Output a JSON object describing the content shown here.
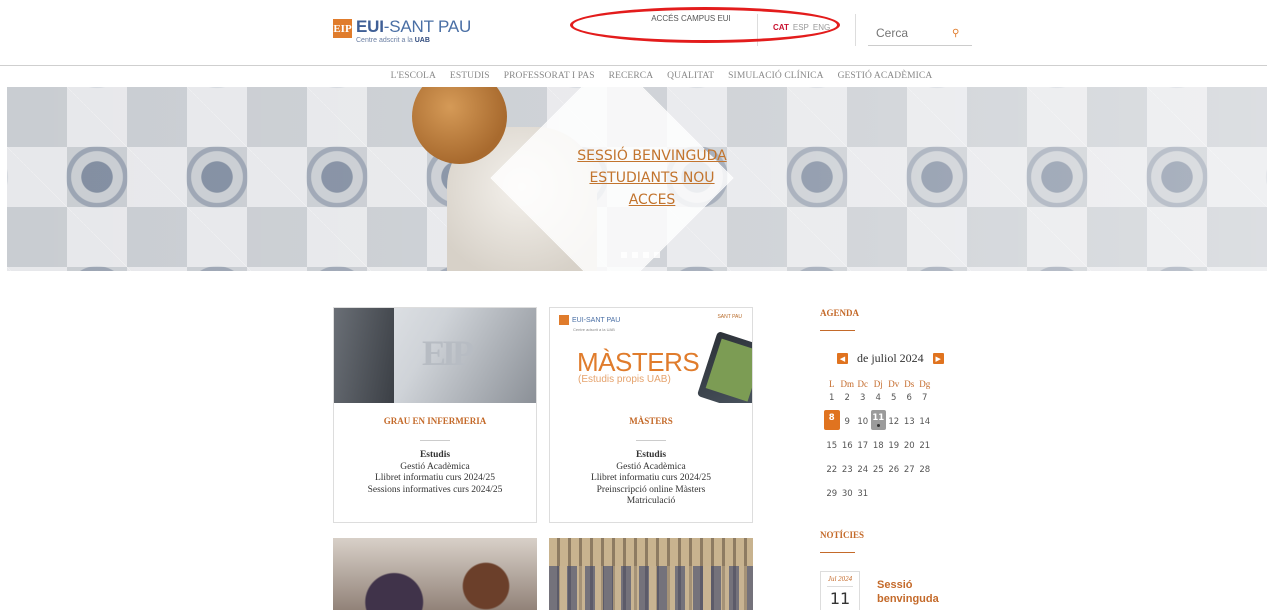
{
  "header": {
    "logo_mark": "EIP",
    "logo_title_a": "EUI",
    "logo_title_b": "-SANT PAU",
    "logo_sub_a": "Centre adscrit a la ",
    "logo_sub_b": "UAB",
    "campus_link": "ACCÉS CAMPUS EUI",
    "languages": [
      "CAT",
      "ESP",
      "ENG"
    ],
    "search_placeholder": "Cerca"
  },
  "nav": {
    "items": [
      "L'ESCOLA",
      "ESTUDIS",
      "PROFESSORAT I PAS",
      "RECERCA",
      "QUALITAT",
      "SIMULACIÓ CLÍNICA",
      "GESTIÓ ACADÈMICA"
    ]
  },
  "hero": {
    "lines": [
      "SESSIÓ BENVINGUDA",
      "ESTUDIANTS NOU",
      "ACCES"
    ],
    "slide_count": 4
  },
  "cards": [
    {
      "title": "GRAU EN INFERMERIA",
      "image_text": "EIP",
      "links": [
        "Estudis",
        "Gestió Acadèmica",
        "Llibret informatiu curs 2024/25",
        "Sessions informatives curs 2024/25"
      ]
    },
    {
      "title": "MÀSTERS",
      "image": {
        "logo": "EUI-SANT PAU",
        "logo_sub": "Centre adscrit a la UAB",
        "right_logo": "SANT PAU",
        "title": "MÀSTERS",
        "subtitle": "(Estudis propis UAB)"
      },
      "links": [
        "Estudis",
        "Gestió Acadèmica",
        "Llibret informatiu curs 2024/25",
        "Preinscripció online Màsters",
        "Matriculació"
      ]
    }
  ],
  "agenda": {
    "heading": "AGENDA",
    "month": "de juliol 2024",
    "weekdays": [
      "L",
      "Dm",
      "Dc",
      "Dj",
      "Dv",
      "Ds",
      "Dg"
    ],
    "weeks": [
      [
        "1",
        "2",
        "3",
        "4",
        "5",
        "6",
        "7"
      ],
      [
        "8",
        "9",
        "10",
        "11",
        "12",
        "13",
        "14"
      ],
      [
        "15",
        "16",
        "17",
        "18",
        "19",
        "20",
        "21"
      ],
      [
        "22",
        "23",
        "24",
        "25",
        "26",
        "27",
        "28"
      ],
      [
        "29",
        "30",
        "31",
        "",
        "",
        "",
        ""
      ]
    ],
    "today": "8",
    "event_day": "11"
  },
  "news": {
    "heading": "NOTÍCIES",
    "items": [
      {
        "month": "Jul 2024",
        "day": "11",
        "title": "Sessió benvinguda"
      }
    ]
  },
  "colors": {
    "accent": "#e0731f",
    "brand_blue": "#4a6fa5",
    "heading": "#c46a2a",
    "annotation": "#e31c1c"
  }
}
